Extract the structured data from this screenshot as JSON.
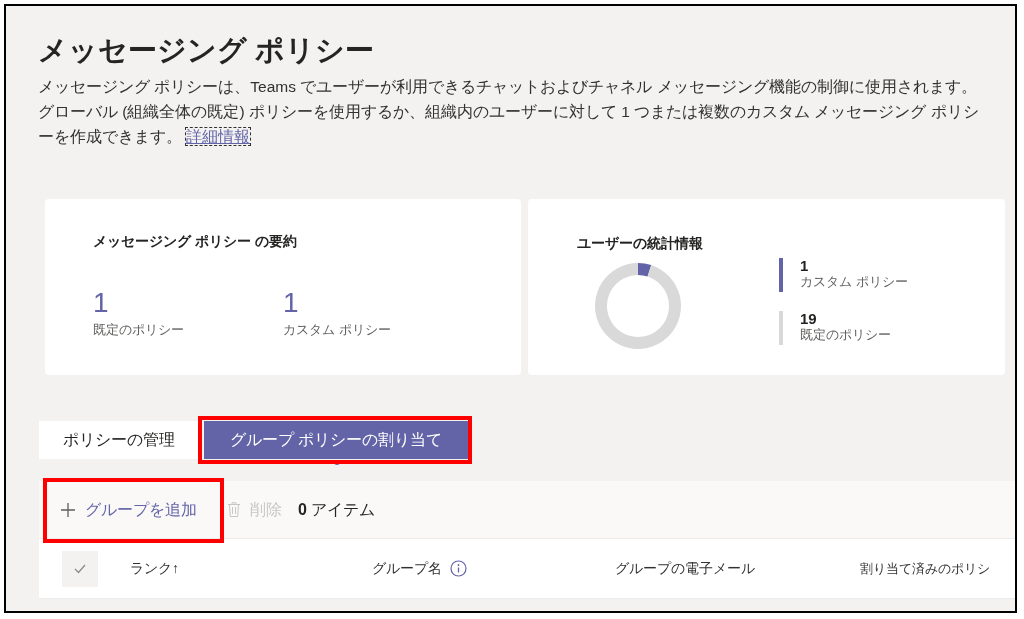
{
  "page": {
    "title": "メッセージング ポリシー",
    "description": "メッセージング ポリシーは、Teams でユーザーが利用できるチャットおよびチャネル メッセージング機能の制御に使用されます。グローバル (組織全体の既定) ポリシーを使用するか、組織内のユーザーに対して 1 つまたは複数のカスタム メッセージング ポリシーを作成できます。",
    "link": "詳細情報"
  },
  "summary_card": {
    "title": "メッセージング ポリシー の要約",
    "stats": [
      {
        "value": "1",
        "label": "既定のポリシー"
      },
      {
        "value": "1",
        "label": "カスタム ポリシー"
      }
    ]
  },
  "user_stats_card": {
    "title": "ユーザーの統計情報",
    "chart_data": {
      "type": "donut",
      "values": [
        5,
        95
      ]
    },
    "legend": [
      {
        "value": "1",
        "label": "カスタム ポリシー",
        "color": "#6264a7"
      },
      {
        "value": "19",
        "label": "既定のポリシー",
        "color": "#d9d9d9"
      }
    ]
  },
  "tabs": [
    {
      "label": "ポリシーの管理",
      "selected": false,
      "highlighted": false
    },
    {
      "label": "グループ ポリシーの割り当て",
      "selected": true,
      "highlighted": true
    }
  ],
  "toolbar": {
    "add": {
      "label": "グループを追加",
      "highlighted": true
    },
    "delete": {
      "label": "削除",
      "disabled": true
    },
    "count_number": "0",
    "count_label": "アイテム"
  },
  "table": {
    "select_all": {
      "checked": false
    },
    "columns": [
      {
        "label": "ランク",
        "sort": "↑",
        "info": false
      },
      {
        "label": "グループ名",
        "info": true
      },
      {
        "label": "グループの電子メール",
        "info": false
      },
      {
        "label": "割り当て済みのポリシ",
        "info": false
      }
    ]
  }
}
